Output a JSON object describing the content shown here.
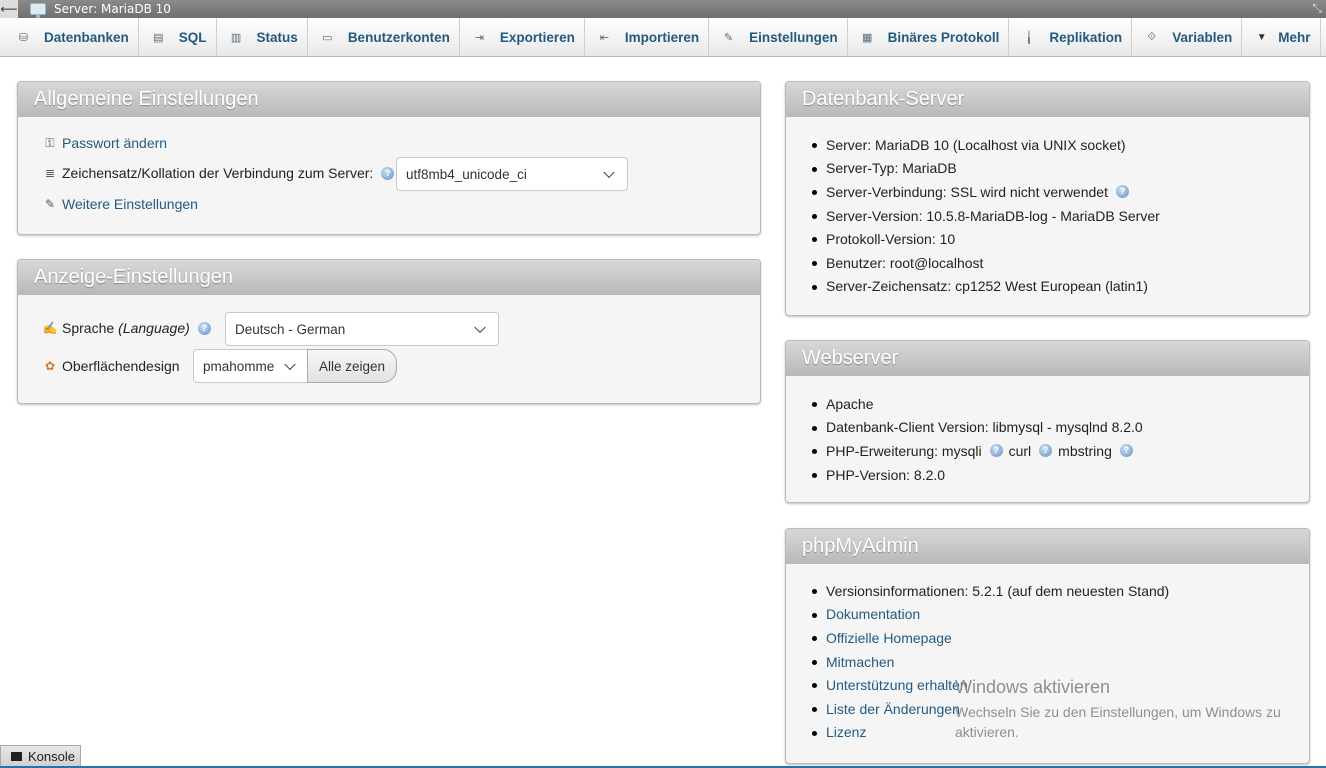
{
  "topbar": {
    "back": "⟵",
    "title": "Server: MariaDB 10",
    "collapse": "⤡"
  },
  "menu": [
    {
      "label": "Datenbanken",
      "icon": "database-icon",
      "glyph": "⛁"
    },
    {
      "label": "SQL",
      "icon": "sql-icon",
      "glyph": "▤"
    },
    {
      "label": "Status",
      "icon": "status-icon",
      "glyph": "▥"
    },
    {
      "label": "Benutzerkonten",
      "icon": "user-accounts-icon",
      "glyph": "▭"
    },
    {
      "label": "Exportieren",
      "icon": "export-icon",
      "glyph": "⇥"
    },
    {
      "label": "Importieren",
      "icon": "import-icon",
      "glyph": "⇤"
    },
    {
      "label": "Einstellungen",
      "icon": "wrench-icon",
      "glyph": "✎"
    },
    {
      "label": "Binäres Protokoll",
      "icon": "binlog-icon",
      "glyph": "▦"
    },
    {
      "label": "Replikation",
      "icon": "replication-icon",
      "glyph": "╽"
    },
    {
      "label": "Variablen",
      "icon": "variables-icon",
      "glyph": "⟐"
    },
    {
      "label": "Mehr",
      "icon": "chevron-down-icon",
      "glyph": "▼"
    }
  ],
  "general": {
    "title": "Allgemeine Einstellungen",
    "password_link": "Passwort ändern",
    "collation_label": "Zeichensatz/Kollation der Verbindung zum Server:",
    "collation_value": "utf8mb4_unicode_ci",
    "more_settings_link": "Weitere Einstellungen"
  },
  "display": {
    "title": "Anzeige-Einstellungen",
    "language_label": "Sprache",
    "language_hint": "(Language)",
    "language_value": "Deutsch - German",
    "theme_label": "Oberflächendesign",
    "theme_value": "pmahomme",
    "show_all_button": "Alle zeigen"
  },
  "db_server": {
    "title": "Datenbank-Server",
    "items": [
      "Server: MariaDB 10 (Localhost via UNIX socket)",
      "Server-Typ: MariaDB",
      "Server-Verbindung: SSL wird nicht verwendet",
      "Server-Version: 10.5.8-MariaDB-log - MariaDB Server",
      "Protokoll-Version: 10",
      "Benutzer: root@localhost",
      "Server-Zeichensatz: cp1252 West European (latin1)"
    ]
  },
  "webserver": {
    "title": "Webserver",
    "items": [
      "Apache",
      "Datenbank-Client Version: libmysql - mysqlnd 8.2.0",
      "PHP-Erweiterung: mysqli",
      "PHP-Version: 8.2.0"
    ],
    "ext_curl": "curl",
    "ext_mbstring": "mbstring"
  },
  "pma": {
    "title": "phpMyAdmin",
    "version": "Versionsinformationen: 5.2.1 (auf dem neuesten Stand)",
    "links": [
      "Dokumentation",
      "Offizielle Homepage",
      "Mitmachen",
      "Unterstützung erhalten",
      "Liste der Änderungen",
      "Lizenz"
    ]
  },
  "watermark": {
    "line1": "Windows aktivieren",
    "line2": "Wechseln Sie zu den Einstellungen, um Windows zu aktivieren."
  },
  "console": {
    "label": "Konsole"
  },
  "help_glyph": "?",
  "colors": {
    "link": "#235a81",
    "panel_header": "#c4c4c4",
    "accent_line": "#2a6fb3"
  }
}
